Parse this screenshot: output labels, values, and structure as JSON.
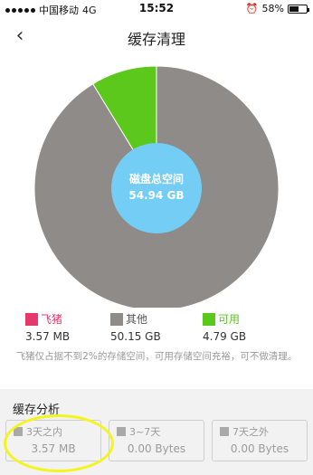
{
  "status_bar": {
    "carrier": "中国移动",
    "network": "4G",
    "time": "15:52",
    "battery_text": "58%",
    "battery_level": 0.58
  },
  "nav": {
    "back_glyph": "‹",
    "title": "缓存清理"
  },
  "chart_data": {
    "type": "pie",
    "center_label": "磁盘总空间",
    "center_value": "54.94 GB",
    "slices": [
      {
        "name": "飞猪",
        "value": 3.57,
        "unit": "MB",
        "color": "#e8386b"
      },
      {
        "name": "其他",
        "value": 50.15,
        "unit": "GB",
        "color": "#8f8b88"
      },
      {
        "name": "可用",
        "value": 4.79,
        "unit": "GB",
        "color": "#5cc81b"
      }
    ]
  },
  "legend": {
    "items": [
      {
        "label": "飞猪",
        "value": "3.57 MB",
        "color": "#e8386b",
        "text_color": "#e8386b"
      },
      {
        "label": "其他",
        "value": "50.15 GB",
        "color": "#8f8b88",
        "text_color": "#555555"
      },
      {
        "label": "可用",
        "value": "4.79 GB",
        "color": "#5cc81b",
        "text_color": "#5cc81b"
      }
    ]
  },
  "note": "飞猪仅占据不到2%的存储空间，可用存储空间充裕，可不做清理。",
  "analysis": {
    "title": "缓存分析",
    "tiles": [
      {
        "label": "3天之内",
        "value": "3.57 MB"
      },
      {
        "label": "3~7天",
        "value": "0.00 Bytes"
      },
      {
        "label": "7天之外",
        "value": "0.00 Bytes"
      }
    ]
  },
  "colors": {
    "center_circle": "#74cdf5",
    "highlight": "#f4f41e"
  }
}
